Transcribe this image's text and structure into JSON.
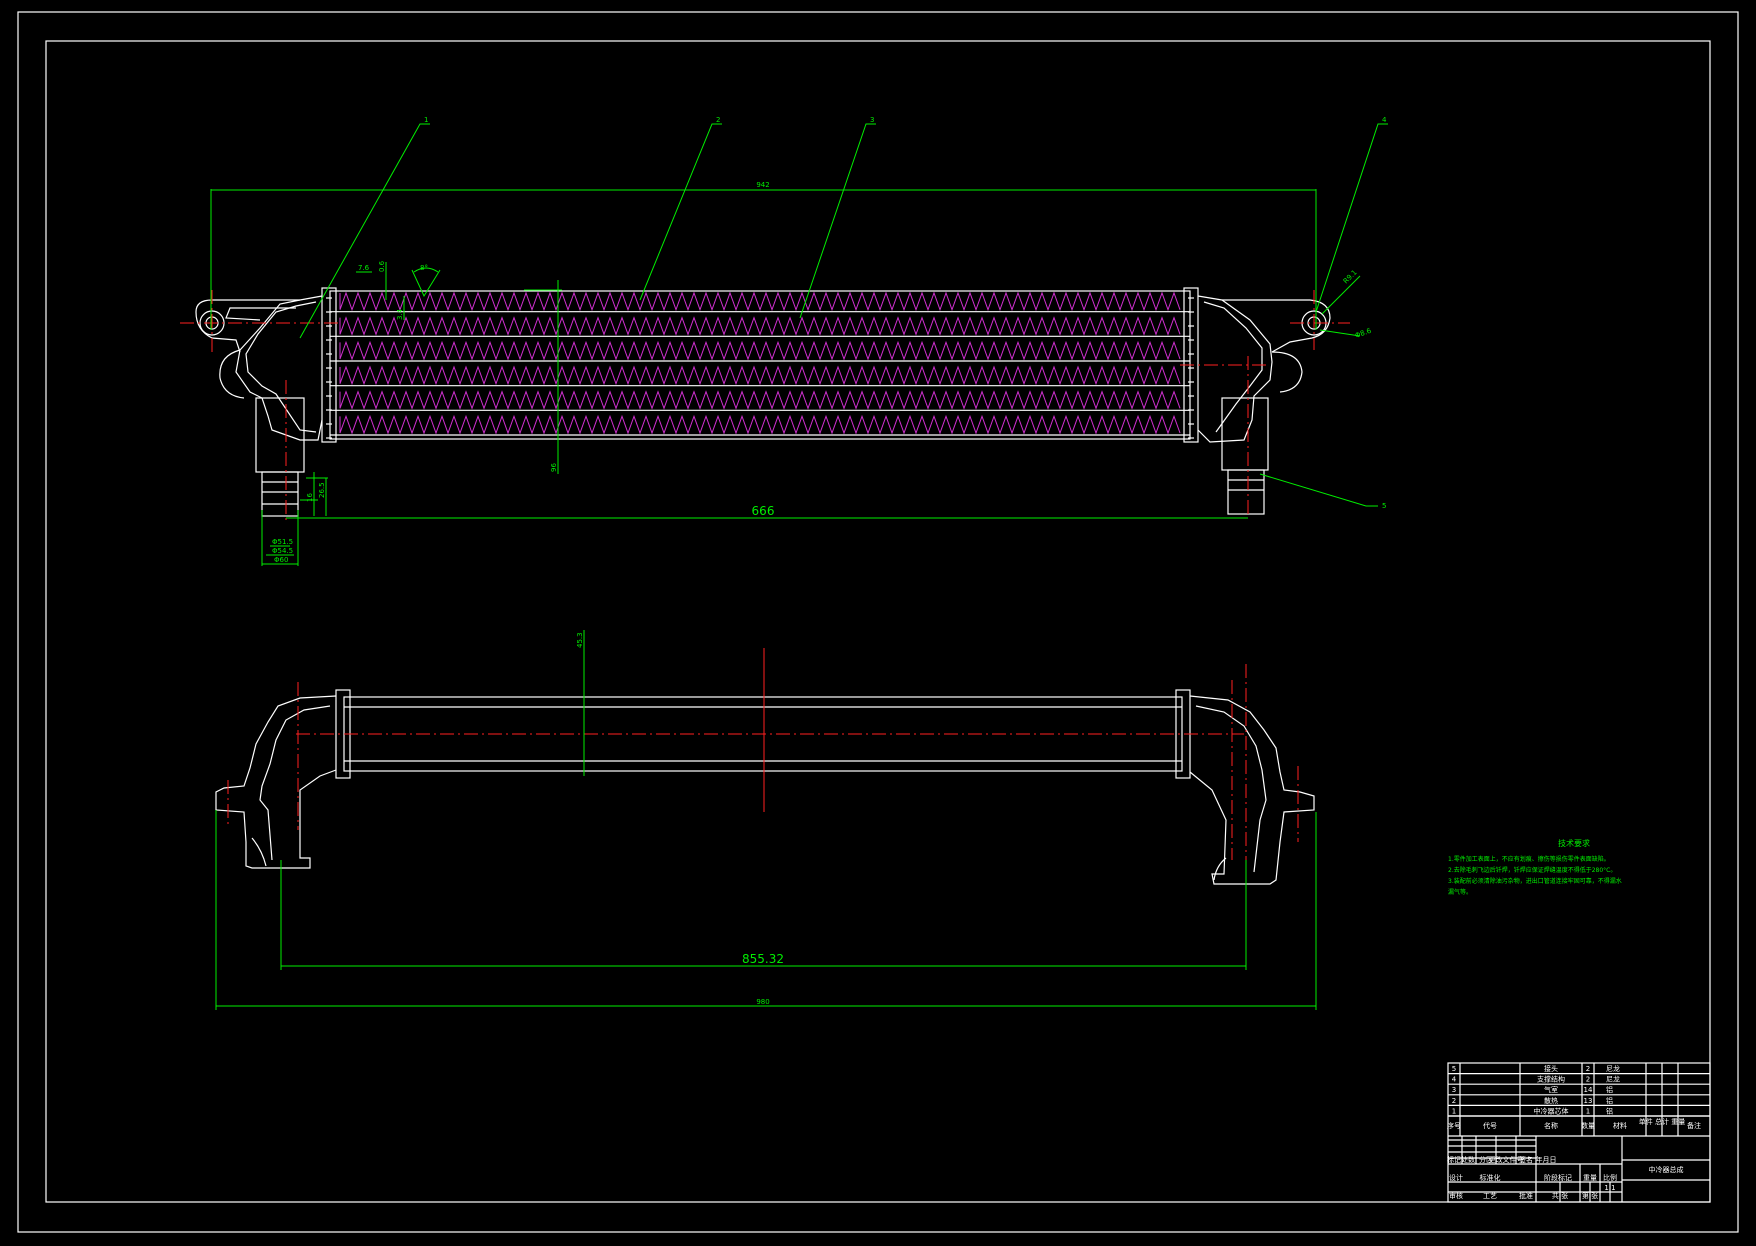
{
  "drawing": {
    "balloons": [
      "1",
      "2",
      "3",
      "4",
      "5"
    ],
    "dimensions": {
      "overall_top": "942",
      "center_distance_top": "666",
      "lower_center_distance": "855.32",
      "overall_bottom": "980",
      "core_height": "96",
      "lower_core_height": "45.3",
      "fin_pitch": "7.6",
      "fin_depth": "0.6",
      "tube_gap": "3.4",
      "fin_angle": "8°",
      "pipe_len_1": "16",
      "pipe_len_2": "26.5",
      "pipe_dia_1": "Φ51.5",
      "pipe_dia_2": "Φ54.5",
      "pipe_dia_3": "Φ60",
      "bracket_r": "R9.1",
      "bracket_hole": "Φ8.6"
    }
  },
  "tech_req": {
    "title": "技术要求",
    "lines": [
      "1.零件加工表面上，不应有划痕、擦伤等损伤零件表面缺陷。",
      "2.去除毛刺飞边后钎焊，钎焊应保证焊缝温度不得低于280°C。",
      "3.装配前必须清除油污杂物，进出口管道连接牢固可靠，不得漏水",
      "漏气等。"
    ]
  },
  "title_block": {
    "parts": [
      {
        "no": "5",
        "name": "接头",
        "qty": "2",
        "material": "尼龙"
      },
      {
        "no": "4",
        "name": "支撑结构",
        "qty": "2",
        "material": "尼龙"
      },
      {
        "no": "3",
        "name": "气室",
        "qty": "14",
        "material": "铝"
      },
      {
        "no": "2",
        "name": "散热",
        "qty": "13",
        "material": "铝"
      },
      {
        "no": "1",
        "name": "中冷器芯体",
        "qty": "1",
        "material": "铝"
      }
    ],
    "header": {
      "no": "序号",
      "code": "代号",
      "name": "名称",
      "qty": "数量",
      "material": "材料",
      "weight": "单件 总计 重量",
      "remark": "备注"
    },
    "drawing_name": "中冷器总成",
    "small_labels": [
      "标记",
      "处数",
      "分区",
      "更改文件号",
      "签名",
      "年月日",
      "设计",
      "标准化",
      "审核",
      "工艺",
      "批准",
      "阶段标记",
      "重量",
      "比例",
      "共 张",
      "第 张",
      "1:1"
    ]
  }
}
